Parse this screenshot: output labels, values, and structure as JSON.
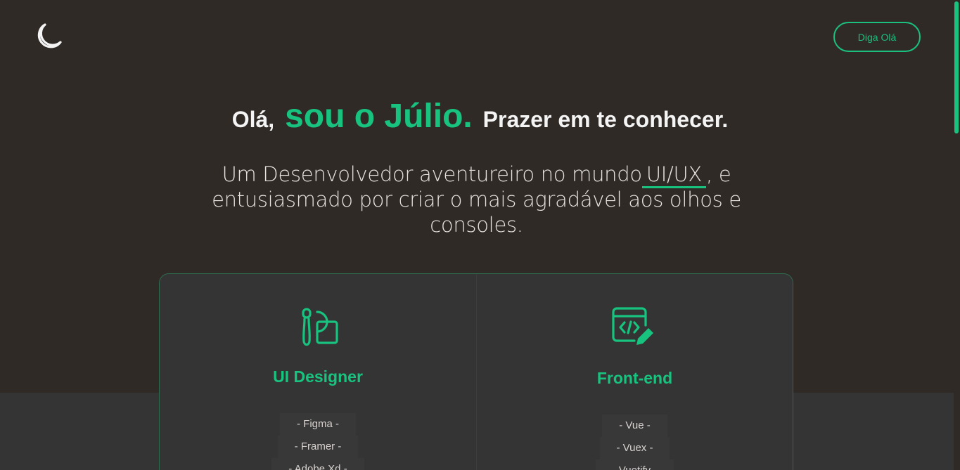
{
  "header": {
    "logo_icon": "moon-icon",
    "cta_label": "Diga Olá"
  },
  "hero": {
    "greeting": "Olá,",
    "name": "sou o Júlio.",
    "tagline": "Prazer em te conhecer.",
    "subtitle_pre": "Um Desenvolvedor aventureiro no mundo",
    "subtitle_highlight": "UI/UX",
    "subtitle_post": ", e entusiasmado por criar o mais agradável aos olhos e consoles."
  },
  "card": {
    "columns": [
      {
        "icon": "brush-shapes-icon",
        "title": "UI Designer",
        "skills": [
          "- Figma -",
          "- Framer -",
          "- Adobe Xd -"
        ]
      },
      {
        "icon": "code-window-pen-icon",
        "title": "Front-end",
        "skills": [
          "- Vue -",
          "- Vuex -",
          "- Vuetify -"
        ]
      }
    ]
  },
  "colors": {
    "accent": "#17c37f",
    "background": "#302a27",
    "card": "#353434"
  }
}
